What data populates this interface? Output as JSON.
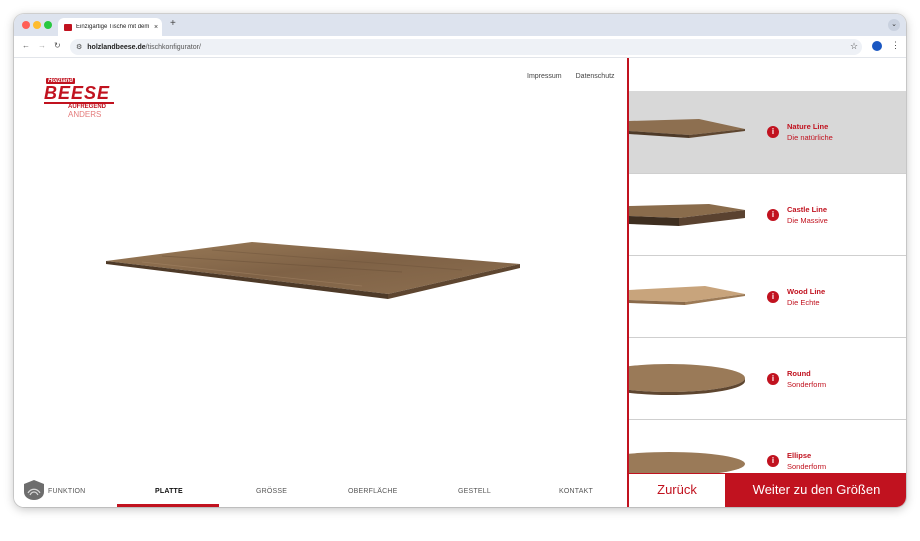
{
  "browser": {
    "tab_title": "Einzigartige Tische mit dem T",
    "tab_close": "×",
    "new_tab": "+",
    "url_domain": "holzlandbeese.de",
    "url_path": "/tischkonfigurator/"
  },
  "header": {
    "logo_top": "Holzland",
    "logo_main": "BEESE",
    "logo_line1": "AUFREGEND",
    "logo_line2": "ANDERS",
    "links": [
      "Impressum",
      "Datenschutz"
    ]
  },
  "bottom_nav": {
    "items": [
      "FUNKTION",
      "PLATTE",
      "GRÖSSE",
      "OBERFLÄCHE",
      "GESTELL",
      "KONTAKT"
    ],
    "active": "PLATTE"
  },
  "sidebar": {
    "cards": [
      {
        "title": "Nature Line",
        "subtitle": "Die natürliche",
        "selected": true
      },
      {
        "title": "Castle Line",
        "subtitle": "Die Massive",
        "selected": false
      },
      {
        "title": "Wood Line",
        "subtitle": "Die Echte",
        "selected": false
      },
      {
        "title": "Round",
        "subtitle": "Sonderform",
        "selected": false
      },
      {
        "title": "Ellipse",
        "subtitle": "Sonderform",
        "selected": false
      }
    ],
    "back_label": "Zurück",
    "next_label": "Weiter zu den Größen"
  },
  "colors": {
    "brand_red": "#c1121f",
    "selected_bg": "#d8d8d8",
    "wood": "#8a6a4a"
  }
}
